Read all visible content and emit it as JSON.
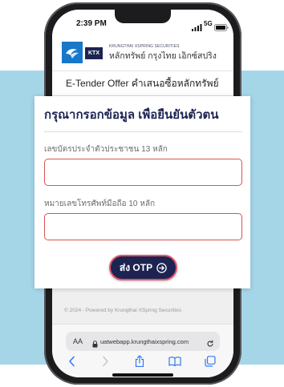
{
  "status_bar": {
    "time": "2:39 PM",
    "network": "5G"
  },
  "header": {
    "brand_badge": "KTX",
    "company_en": "KRUNGTHAI XSPRING SECURITIES",
    "company_th": "หลักทรัพย์ กรุงไทย เอ็กซ์สปริง"
  },
  "page": {
    "title": "E-Tender Offer คำเสนอซื้อหลักทรัพย์"
  },
  "modal": {
    "heading": "กรุณากรอกข้อมูล เพื่อยืนยันตัวตน",
    "fields": [
      {
        "label": "เลขบัตรประจำตัวประชาชน 13 หลัก"
      },
      {
        "label": "หมายเลขโทรศัพท์มือถือ 10 หลัก"
      }
    ],
    "submit_label": "ส่ง OTP"
  },
  "footer": {
    "copyright": "© 2024 - Powered by Krungthai XSpring Securities"
  },
  "browser": {
    "text_size_label": "AA",
    "url": "uatwebapp.krungthaixspring.com"
  },
  "icons": {
    "signal": "signal-bars-icon",
    "battery": "battery-icon",
    "logo": "krungthai-logo-icon",
    "lock": "lock-icon",
    "reload": "reload-icon",
    "back": "back-chevron-icon",
    "forward": "forward-chevron-icon",
    "share": "share-icon",
    "bookmarks": "bookmarks-icon",
    "tabs": "tabs-icon",
    "submit_arrow": "arrow-circle-right-icon"
  },
  "colors": {
    "background_band": "#a5d6e8",
    "brand_navy": "#1d2452",
    "brand_blue": "#1877c9",
    "input_border_error": "#d9534f",
    "button_border": "#e0566b",
    "safari_blue": "#3478f6"
  }
}
